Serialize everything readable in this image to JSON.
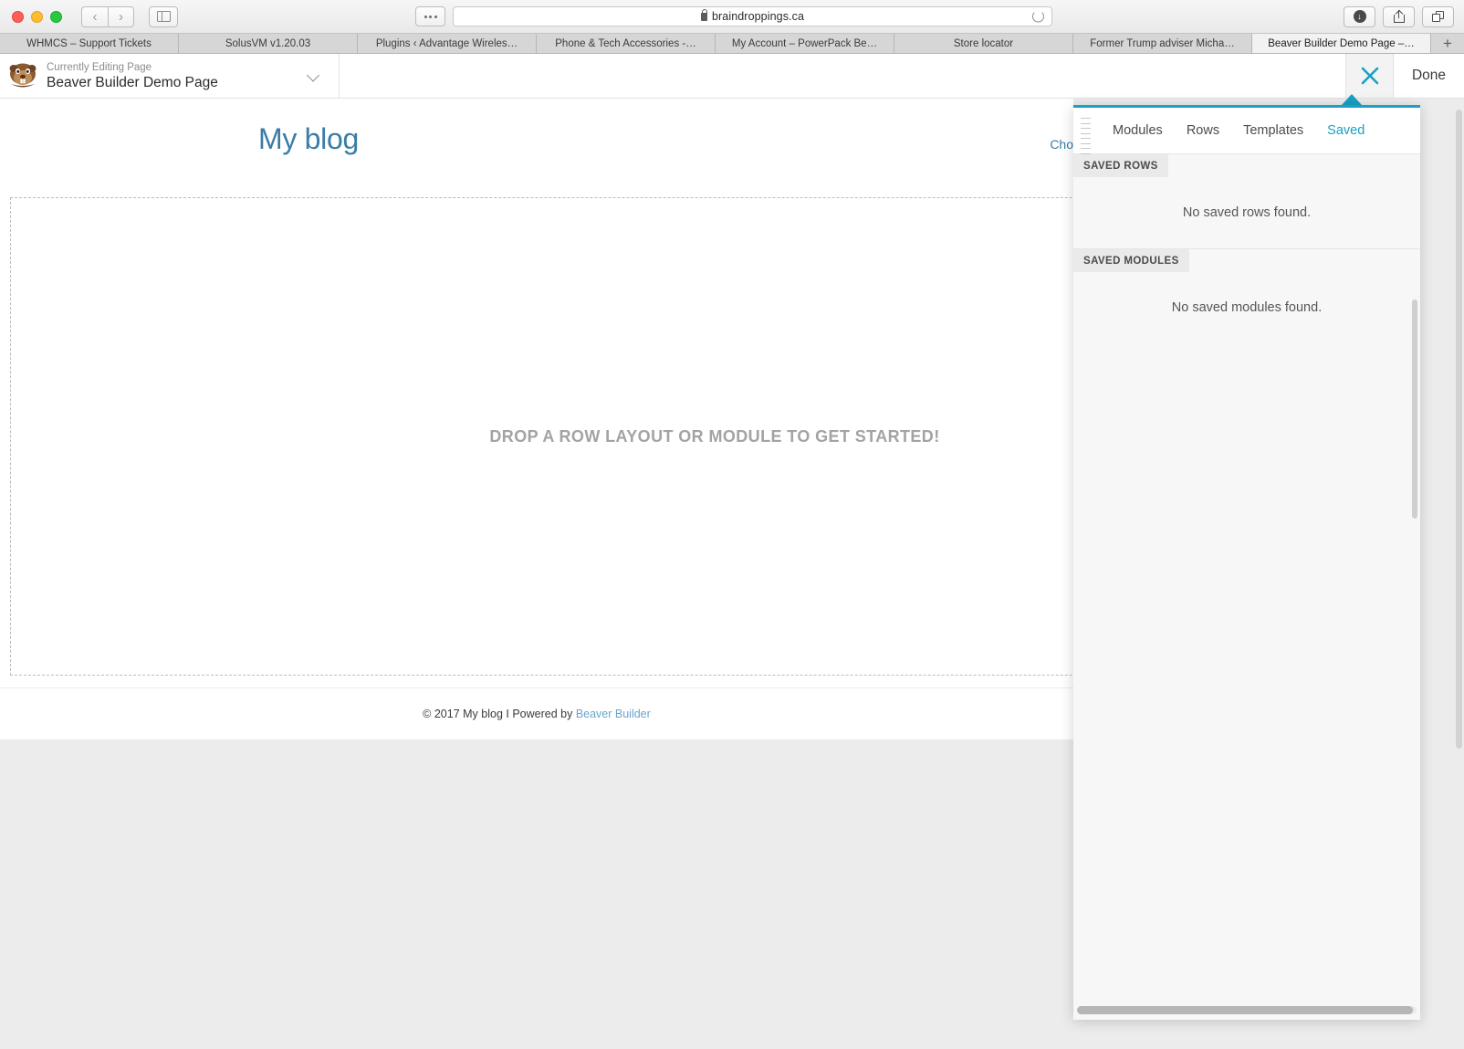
{
  "browser": {
    "url": "braindroppings.ca",
    "lock_icon": "lock-icon",
    "back_glyph": "‹",
    "forward_glyph": "›",
    "download_glyph": "↓",
    "newtab_glyph": "+",
    "tabs": [
      {
        "label": "WHMCS – Support Tickets",
        "active": false
      },
      {
        "label": "SolusVM v1.20.03",
        "active": false
      },
      {
        "label": "Plugins ‹ Advantage Wireles…",
        "active": false
      },
      {
        "label": "Phone & Tech Accessories -…",
        "active": false
      },
      {
        "label": "My Account – PowerPack Be…",
        "active": false
      },
      {
        "label": "Store locator",
        "active": false
      },
      {
        "label": "Former Trump adviser Micha…",
        "active": false
      },
      {
        "label": "Beaver Builder Demo Page –…",
        "active": true
      }
    ]
  },
  "admin_bar": {
    "logo_icon": "beaver-logo-icon",
    "subtitle": "Currently Editing Page",
    "title": "Beaver Builder Demo Page",
    "caret_icon": "chevron-down-icon",
    "close_icon": "close-icon",
    "done_label": "Done"
  },
  "site": {
    "logo": "My blog",
    "nav_clipped": "Cho",
    "drop_text": "DROP A ROW LAYOUT OR MODULE TO GET STARTED!",
    "footer_prefix": "© 2017 My blog I Powered by ",
    "footer_link": "Beaver Builder"
  },
  "panel": {
    "tabs": [
      {
        "label": "Modules",
        "active": false
      },
      {
        "label": "Rows",
        "active": false
      },
      {
        "label": "Templates",
        "active": false
      },
      {
        "label": "Saved",
        "active": true
      }
    ],
    "sections": [
      {
        "heading": "SAVED ROWS",
        "empty_text": "No saved rows found."
      },
      {
        "heading": "SAVED MODULES",
        "empty_text": "No saved modules found."
      }
    ]
  },
  "colors": {
    "accent": "#19a0c4",
    "link": "#3a7ca8",
    "chrome": "#e9e9e9",
    "tabbar": "#d6d6d6",
    "panel_bg": "#f7f7f7"
  }
}
